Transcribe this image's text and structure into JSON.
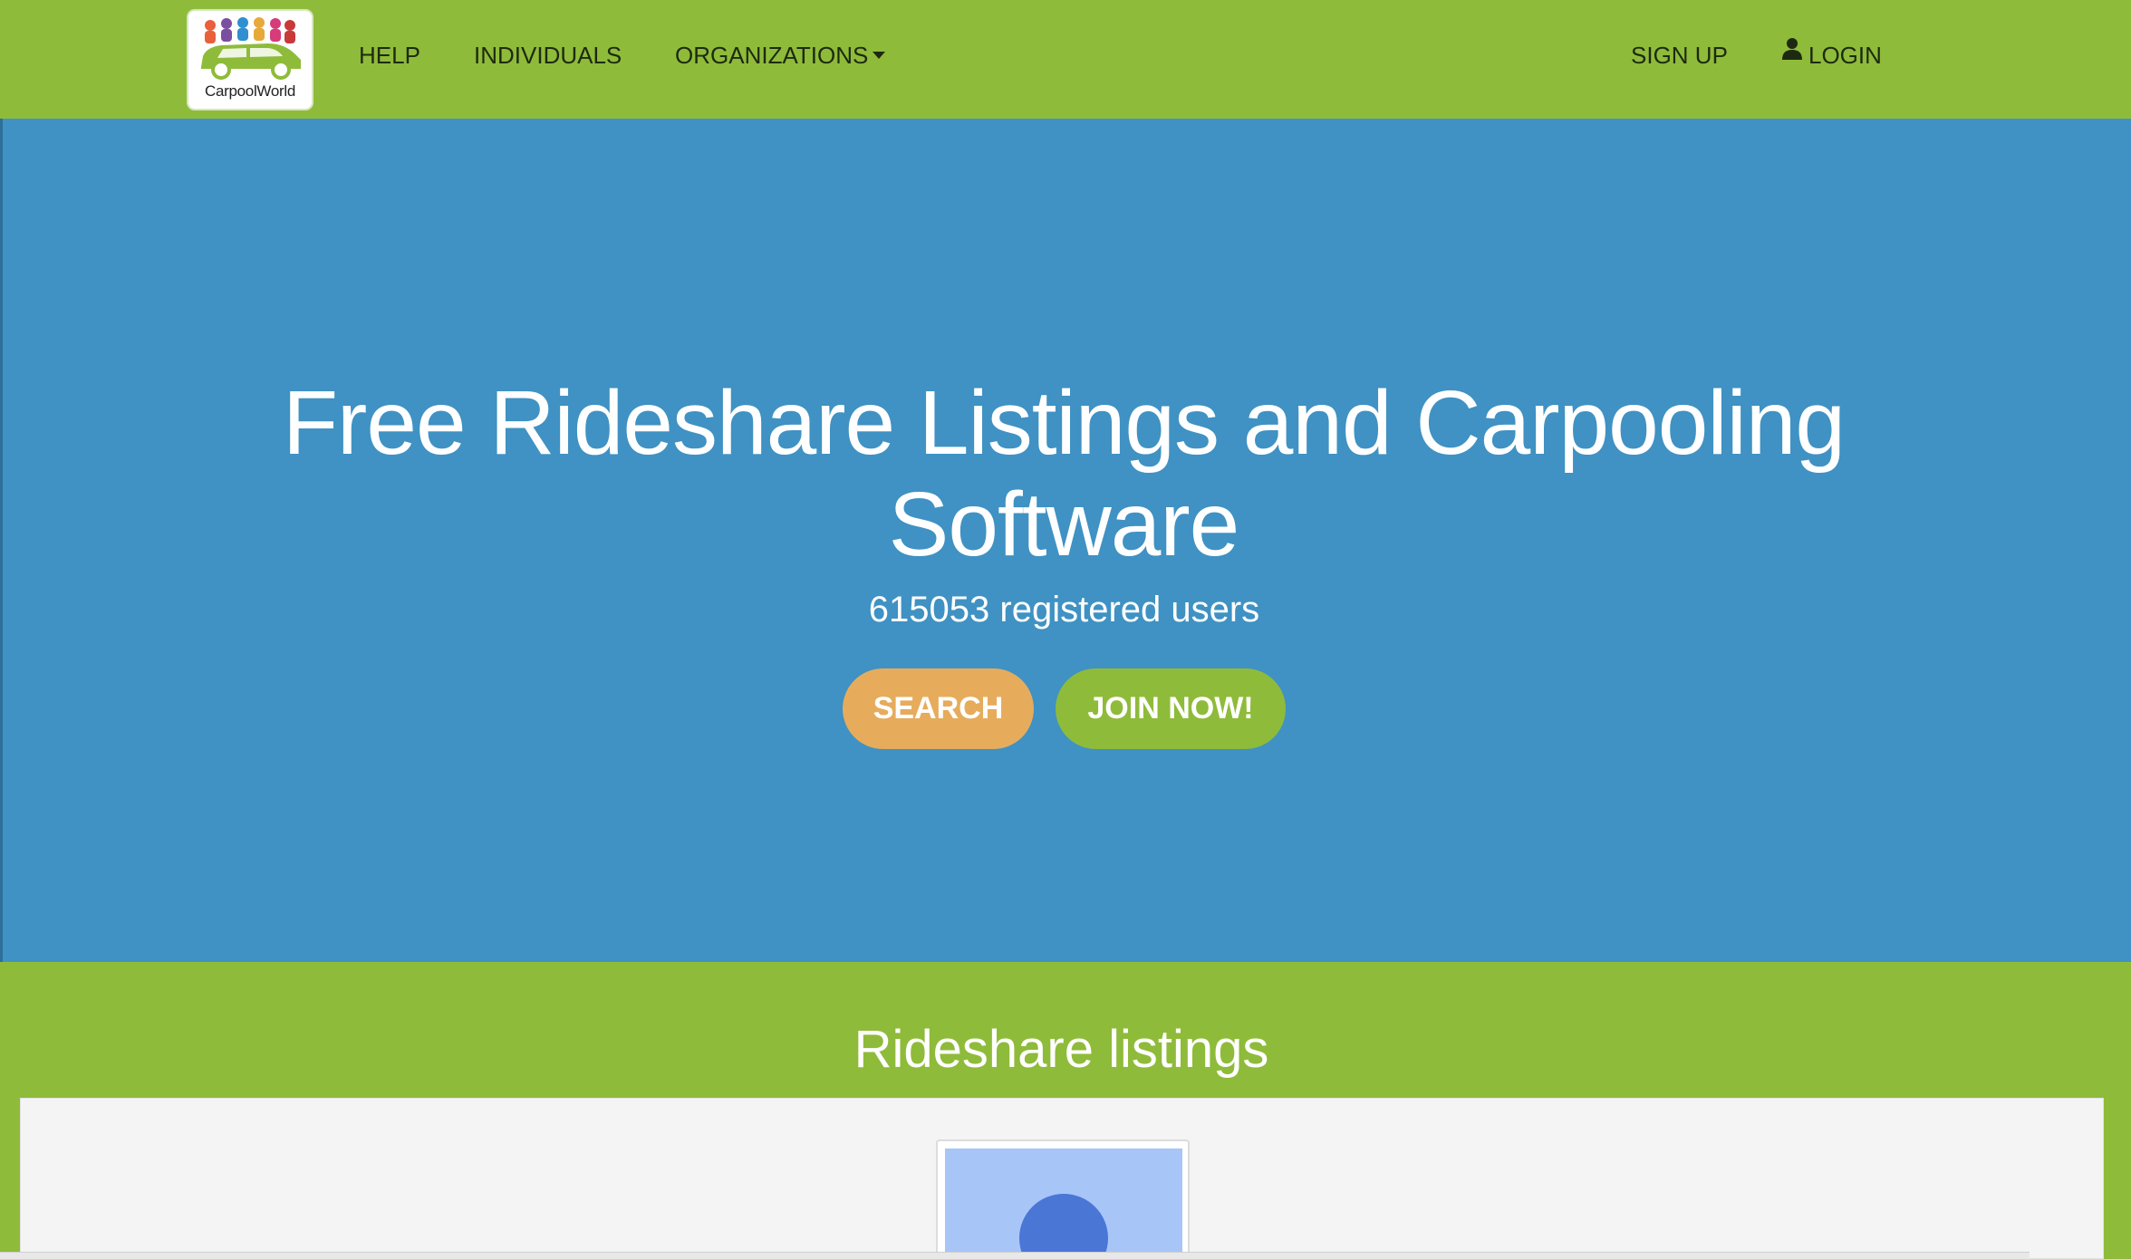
{
  "brand": {
    "name": "CarpoolWorld"
  },
  "nav": {
    "help": "HELP",
    "individuals": "INDIVIDUALS",
    "organizations": "ORGANIZATIONS",
    "sign_up": "SIGN UP",
    "login": "LOGIN"
  },
  "hero": {
    "title": "Free Rideshare Listings and Carpooling Software",
    "registered_users": "615053 registered users",
    "search_button": "SEARCH",
    "join_button": "JOIN NOW!"
  },
  "listings": {
    "title": "Rideshare listings"
  },
  "colors": {
    "brand_green": "#8fbb3a",
    "hero_blue": "#3f92c3",
    "search_orange": "#e6ac5c",
    "avatar_blue": "#4a76d6"
  },
  "icons": {
    "organizations_caret": "chevron-down-icon",
    "login_icon": "user-icon"
  }
}
